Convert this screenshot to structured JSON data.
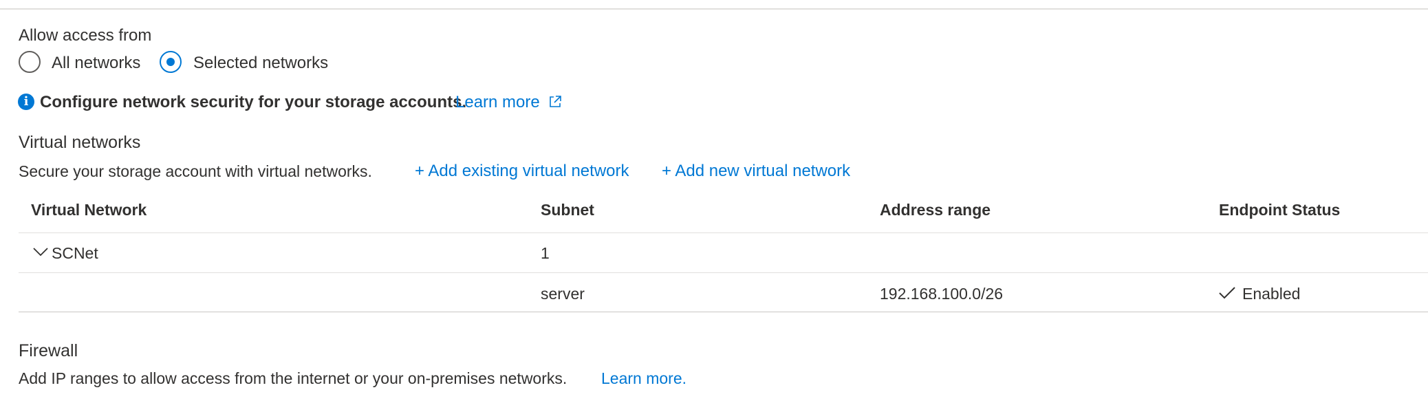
{
  "access": {
    "heading": "Allow access from",
    "options": [
      {
        "label": "All networks",
        "selected": false
      },
      {
        "label": "Selected networks",
        "selected": true
      }
    ]
  },
  "info": {
    "icon": "info-icon",
    "text": "Configure network security for your storage accounts.",
    "link": "Learn more",
    "link_icon": "external-link-icon"
  },
  "vnet": {
    "title": "Virtual networks",
    "description": "Secure your storage account with virtual networks.",
    "add_existing": "+ Add existing virtual network",
    "add_new": "+ Add new virtual network",
    "columns": [
      "Virtual Network",
      "Subnet",
      "Address range",
      "Endpoint Status"
    ],
    "group": {
      "name": "SCNet",
      "subnet_count": "1",
      "expand_icon": "chevron-down-icon"
    },
    "rows": [
      {
        "subnet": "server",
        "address_range": "192.168.100.0/26",
        "status": "Enabled",
        "status_icon": "checkmark-icon"
      }
    ]
  },
  "firewall": {
    "title": "Firewall",
    "description": "Add IP ranges to allow access from the internet or your on-premises networks.",
    "link": "Learn more."
  },
  "colors": {
    "accent": "#0078d4",
    "text": "#323130",
    "divider": "#e1dfdd"
  }
}
